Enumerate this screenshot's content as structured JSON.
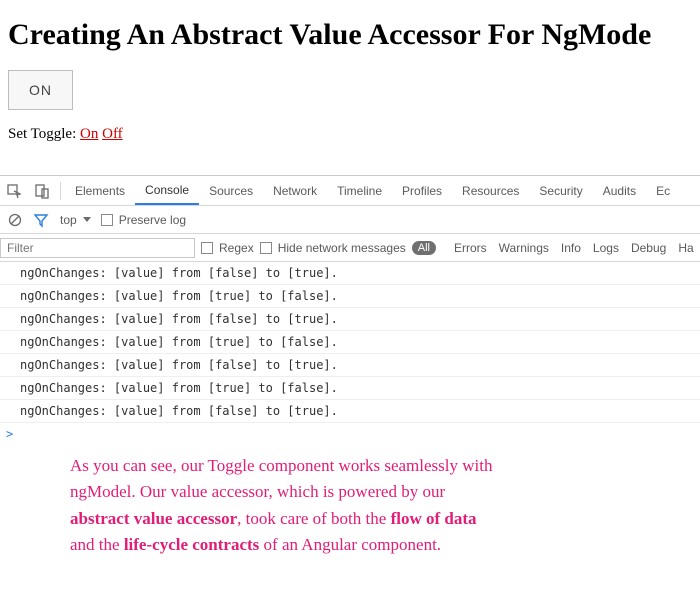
{
  "page": {
    "heading": "Creating An Abstract Value Accessor For NgMode",
    "toggle_label": "ON",
    "set_prefix": "Set Toggle: ",
    "link_on": "On",
    "link_off": "Off"
  },
  "devtools": {
    "tabs": [
      "Elements",
      "Console",
      "Sources",
      "Network",
      "Timeline",
      "Profiles",
      "Resources",
      "Security",
      "Audits",
      "Ec"
    ],
    "active_tab": "Console",
    "toolbar": {
      "context": "top",
      "preserve_log": "Preserve log"
    },
    "filterbar": {
      "filter_placeholder": "Filter",
      "regex": "Regex",
      "hide_network": "Hide network messages",
      "all": "All",
      "levels": [
        "Errors",
        "Warnings",
        "Info",
        "Logs",
        "Debug",
        "Ha"
      ]
    },
    "console": [
      "ngOnChanges: [value] from [false] to [true].",
      "ngOnChanges: [value] from [true] to [false].",
      "ngOnChanges: [value] from [false] to [true].",
      "ngOnChanges: [value] from [true] to [false].",
      "ngOnChanges: [value] from [false] to [true].",
      "ngOnChanges: [value] from [true] to [false].",
      "ngOnChanges: [value] from [false] to [true]."
    ],
    "prompt": ">"
  },
  "annotation": {
    "l1": "As you can see, our Toggle component works seamlessly with",
    "l2a": "ngModel. Our value accessor, which is powered by our",
    "l3a": "abstract value accessor",
    "l3b": ", took care of both the ",
    "l3c": "flow of data",
    "l4a": "and the ",
    "l4b": "life-cycle contracts",
    "l4c": " of an Angular component."
  }
}
